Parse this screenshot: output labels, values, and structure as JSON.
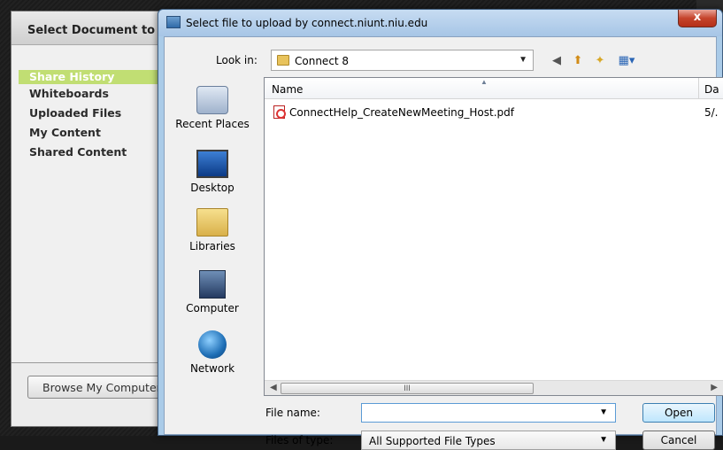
{
  "panel": {
    "title": "Select Document to Share",
    "items": [
      {
        "label": "Share History",
        "selected": true
      },
      {
        "label": "Whiteboards",
        "selected": false
      },
      {
        "label": "Uploaded Files",
        "selected": false
      },
      {
        "label": "My Content",
        "selected": false
      },
      {
        "label": "Shared Content",
        "selected": false
      }
    ],
    "browse_label": "Browse My Computer..."
  },
  "dialog": {
    "title": "Select file to upload by connect.niunt.niu.edu",
    "close_label": "x",
    "look_in_label": "Look in:",
    "look_in_value": "Connect 8",
    "toolbar_icons": [
      "back-icon",
      "up-folder-icon",
      "new-folder-icon",
      "view-menu-icon"
    ],
    "places": [
      {
        "label": "Recent Places",
        "icon": "recent-places-icon"
      },
      {
        "label": "Desktop",
        "icon": "desktop-icon"
      },
      {
        "label": "Libraries",
        "icon": "libraries-icon"
      },
      {
        "label": "Computer",
        "icon": "computer-icon"
      },
      {
        "label": "Network",
        "icon": "network-icon"
      }
    ],
    "columns": {
      "name": "Name",
      "date": "Da"
    },
    "files": [
      {
        "name": "ConnectHelp_CreateNewMeeting_Host.pdf",
        "date": "5/."
      }
    ],
    "scroll_thumb_glyph": "III",
    "file_name_label": "File name:",
    "file_name_value": "",
    "files_of_type_label": "Files of type:",
    "files_of_type_value": "All Supported File Types",
    "open_label": "Open",
    "cancel_label": "Cancel",
    "colors": {
      "accent_selection": "#c1de73",
      "title_bar": "#a6c5e6",
      "close": "#c5442c"
    }
  }
}
